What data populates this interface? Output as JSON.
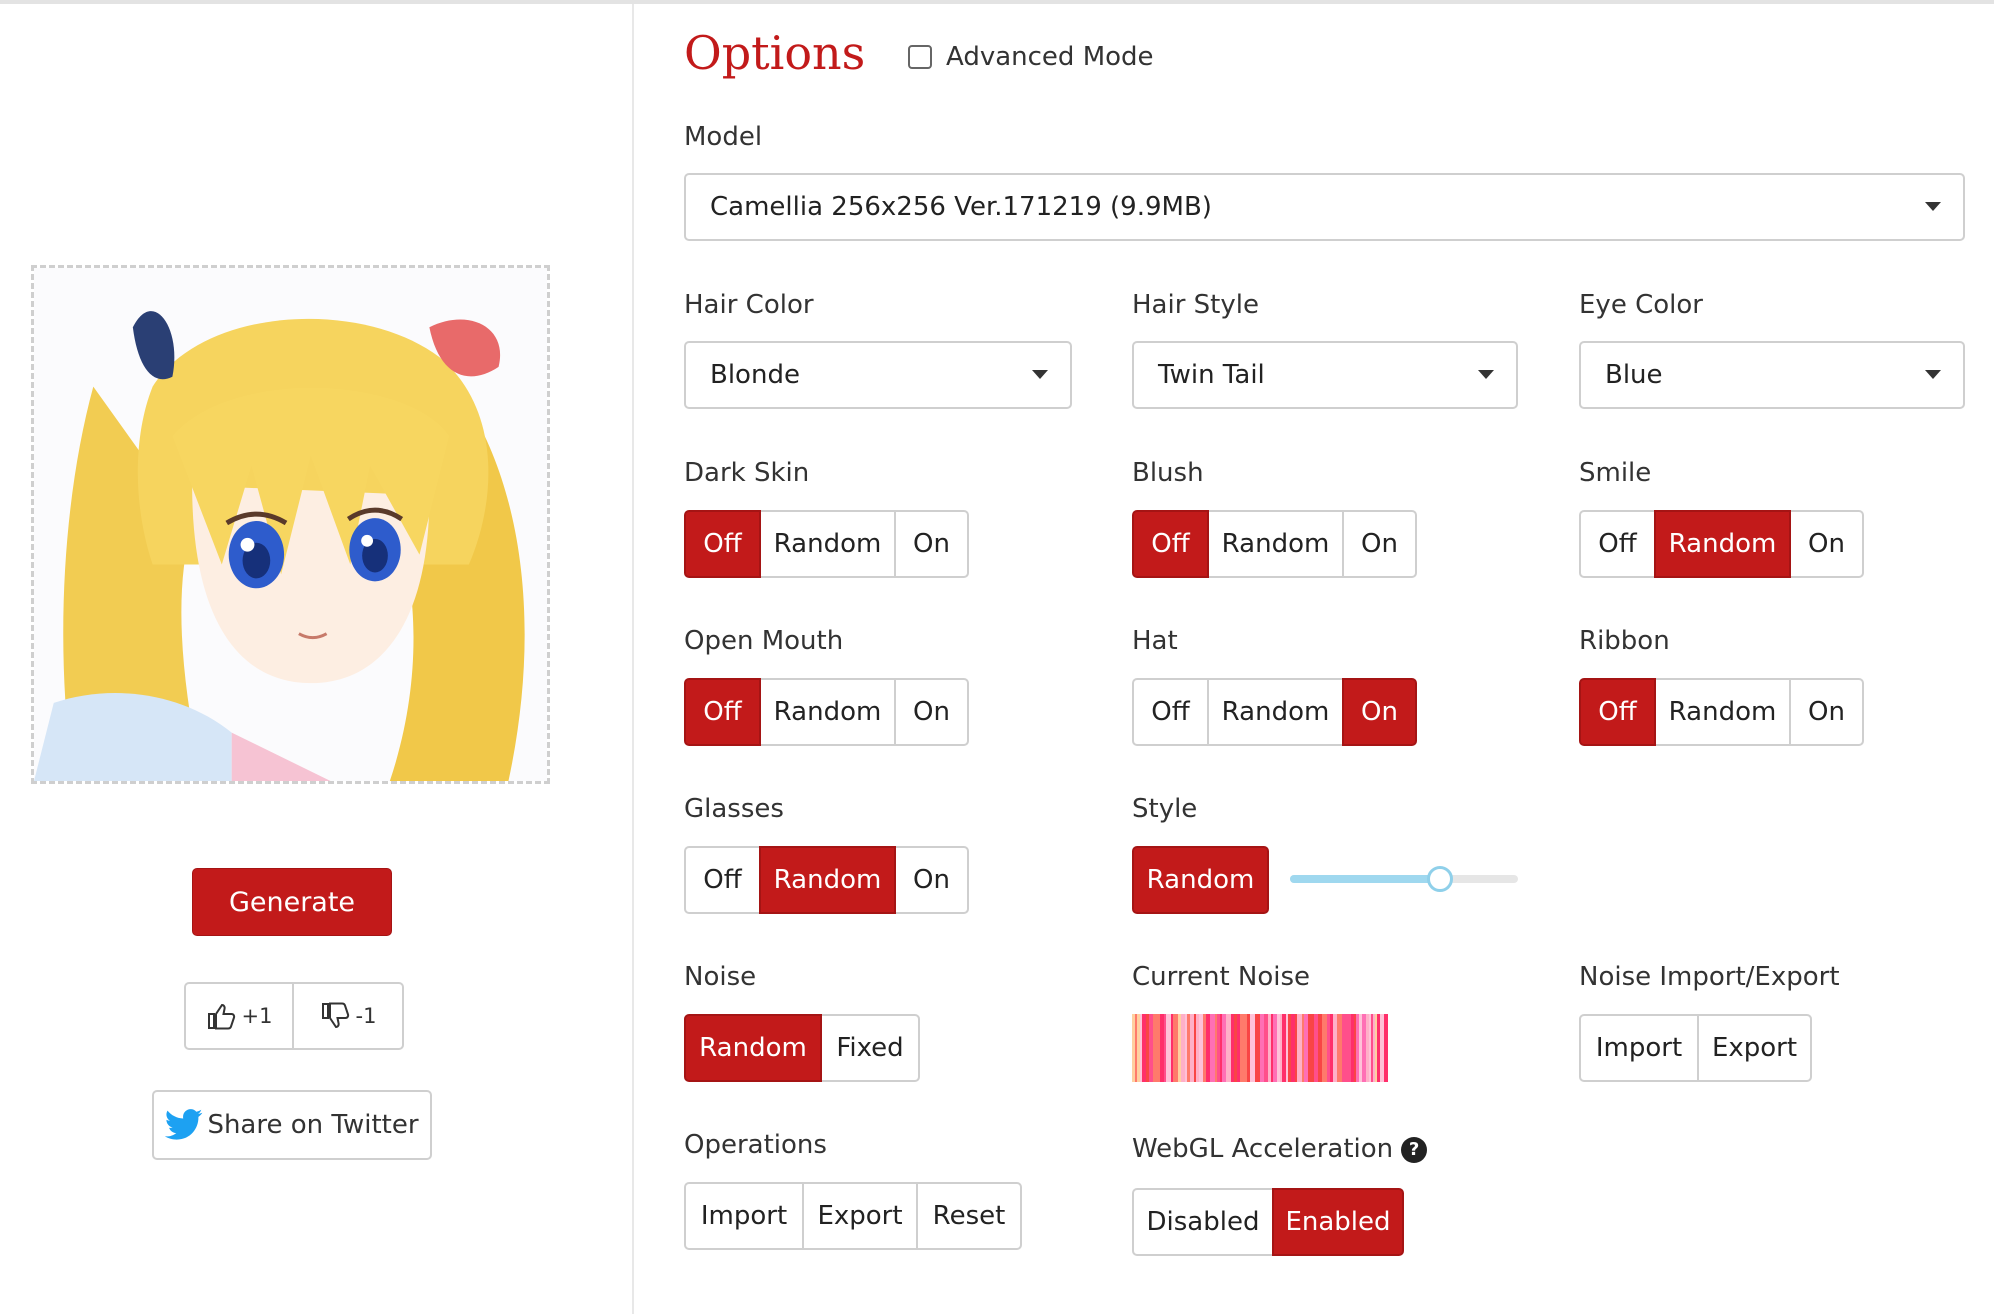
{
  "left": {
    "generate_label": "Generate",
    "upvote_label": "+1",
    "downvote_label": "-1",
    "share_label": "Share on Twitter"
  },
  "options": {
    "title": "Options",
    "advanced_mode_label": "Advanced Mode",
    "advanced_mode_checked": false,
    "model": {
      "label": "Model",
      "value": "Camellia 256x256 Ver.171219 (9.9MB)"
    },
    "hair_color": {
      "label": "Hair Color",
      "value": "Blonde"
    },
    "hair_style": {
      "label": "Hair Style",
      "value": "Twin Tail"
    },
    "eye_color": {
      "label": "Eye Color",
      "value": "Blue"
    },
    "dark_skin": {
      "label": "Dark Skin",
      "options": [
        "Off",
        "Random",
        "On"
      ],
      "selected": "Off"
    },
    "blush": {
      "label": "Blush",
      "options": [
        "Off",
        "Random",
        "On"
      ],
      "selected": "Off"
    },
    "smile": {
      "label": "Smile",
      "options": [
        "Off",
        "Random",
        "On"
      ],
      "selected": "Random"
    },
    "open_mouth": {
      "label": "Open Mouth",
      "options": [
        "Off",
        "Random",
        "On"
      ],
      "selected": "Off"
    },
    "hat": {
      "label": "Hat",
      "options": [
        "Off",
        "Random",
        "On"
      ],
      "selected": "On"
    },
    "ribbon": {
      "label": "Ribbon",
      "options": [
        "Off",
        "Random",
        "On"
      ],
      "selected": "Off"
    },
    "glasses": {
      "label": "Glasses",
      "options": [
        "Off",
        "Random",
        "On"
      ],
      "selected": "Random"
    },
    "style": {
      "label": "Style",
      "button": "Random",
      "slider_value": 0.66
    },
    "noise": {
      "label": "Noise",
      "options": [
        "Random",
        "Fixed"
      ],
      "selected": "Random"
    },
    "current_noise": {
      "label": "Current Noise"
    },
    "noise_import_export": {
      "label": "Noise Import/Export",
      "options": [
        "Import",
        "Export"
      ]
    },
    "operations": {
      "label": "Operations",
      "options": [
        "Import",
        "Export",
        "Reset"
      ]
    },
    "webgl": {
      "label": "WebGL Acceleration",
      "help": "?",
      "options": [
        "Disabled",
        "Enabled"
      ],
      "selected": "Enabled"
    }
  },
  "colors": {
    "accent": "#c21a1a",
    "slider": "#9fd8ef",
    "twitter": "#1da1f2"
  },
  "icons": [
    "thumbs-up-icon",
    "thumbs-down-icon",
    "twitter-bird-icon",
    "chevron-down-icon",
    "help-icon"
  ]
}
